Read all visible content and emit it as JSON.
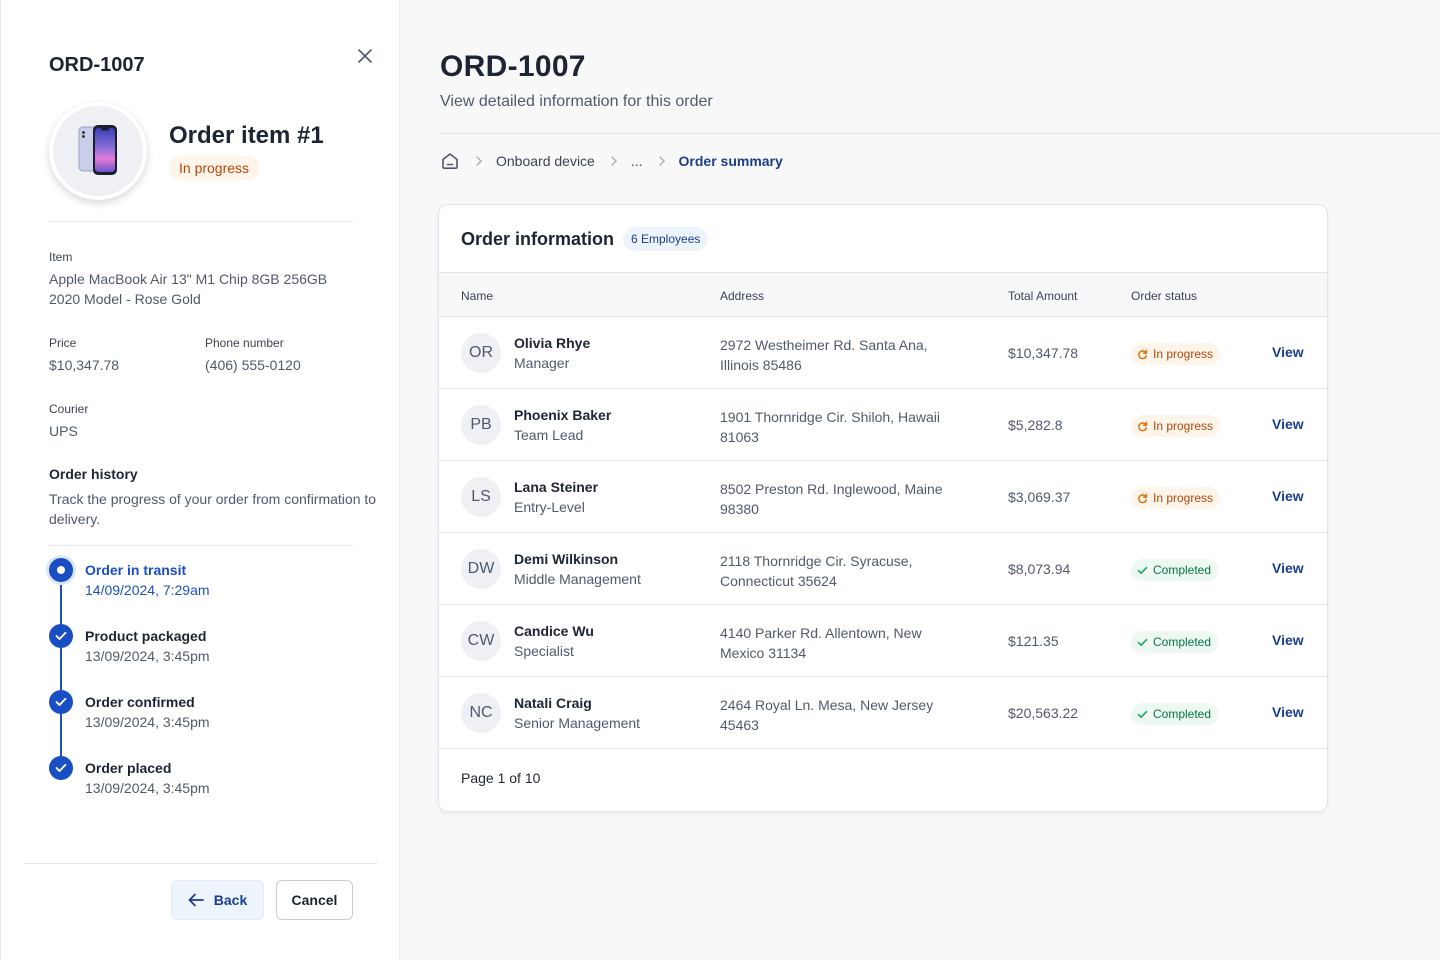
{
  "drawer": {
    "title": "ORD-1007",
    "item_title": "Order item #1",
    "item_status": "In progress",
    "item_label": "Item",
    "item_value": "Apple MacBook Air 13\" M1 Chip 8GB 256GB 2020 Model - Rose Gold",
    "price_label": "Price",
    "price_value": "$10,347.78",
    "phone_label": "Phone number",
    "phone_value": "(406) 555-0120",
    "courier_label": "Courier",
    "courier_value": "UPS",
    "history_title": "Order history",
    "history_desc": "Track the progress of your order from confirmation to delivery.",
    "timeline": [
      {
        "title": "Order in transit",
        "date": "14/09/2024, 7:29am"
      },
      {
        "title": "Product packaged",
        "date": "13/09/2024, 3:45pm"
      },
      {
        "title": "Order confirmed",
        "date": "13/09/2024, 3:45pm"
      },
      {
        "title": "Order placed",
        "date": "13/09/2024, 3:45pm"
      }
    ],
    "back_label": "Back",
    "cancel_label": "Cancel"
  },
  "main": {
    "title": "ORD-1007",
    "subtitle": "View detailed information for this order",
    "breadcrumb": [
      "Onboard device",
      "...",
      "Order summary"
    ]
  },
  "card": {
    "title": "Order information",
    "badge": "6 Employees",
    "columns": [
      "Name",
      "Address",
      "Total Amount",
      "Order status"
    ],
    "rows": [
      {
        "initials": "OR",
        "name": "Olivia Rhye",
        "role": "Manager",
        "address": "2972 Westheimer Rd. Santa Ana, Illinois 85486",
        "amount": "$10,347.78",
        "status": "In progress",
        "action": "View"
      },
      {
        "initials": "PB",
        "name": "Phoenix Baker",
        "role": "Team Lead",
        "address": "1901 Thornridge Cir. Shiloh, Hawaii 81063",
        "amount": "$5,282.8",
        "status": "In progress",
        "action": "View"
      },
      {
        "initials": "LS",
        "name": "Lana Steiner",
        "role": "Entry-Level",
        "address": "8502 Preston Rd. Inglewood, Maine 98380",
        "amount": "$3,069.37",
        "status": "In progress",
        "action": "View"
      },
      {
        "initials": "DW",
        "name": "Demi Wilkinson",
        "role": "Middle Management",
        "address": "2118 Thornridge Cir. Syracuse, Connecticut 35624",
        "amount": "$8,073.94",
        "status": "Completed",
        "action": "View"
      },
      {
        "initials": "CW",
        "name": "Candice Wu",
        "role": "Specialist",
        "address": "4140 Parker Rd. Allentown, New Mexico 31134",
        "amount": "$121.35",
        "status": "Completed",
        "action": "View"
      },
      {
        "initials": "NC",
        "name": "Natali Craig",
        "role": "Senior Management",
        "address": "2464 Royal Ln. Mesa, New Jersey 45463",
        "amount": "$20,563.22",
        "status": "Completed",
        "action": "View"
      }
    ],
    "pagination": "Page 1 of 10"
  },
  "colors": {
    "accent": "#1a4fc4",
    "link": "#1a3e8c",
    "in_progress_bg": "#fdf4ea",
    "in_progress_fg": "#b54708",
    "completed_bg": "#ecf8f1",
    "completed_fg": "#067647"
  },
  "icons": {
    "close": "close-icon",
    "home": "home-icon",
    "breadcrumb_separator": "chevron-right-icon",
    "back": "arrow-left-icon",
    "in_progress": "refresh-icon",
    "completed": "check-icon",
    "timeline_done": "check-circle-icon",
    "product": "phone-product-image"
  }
}
